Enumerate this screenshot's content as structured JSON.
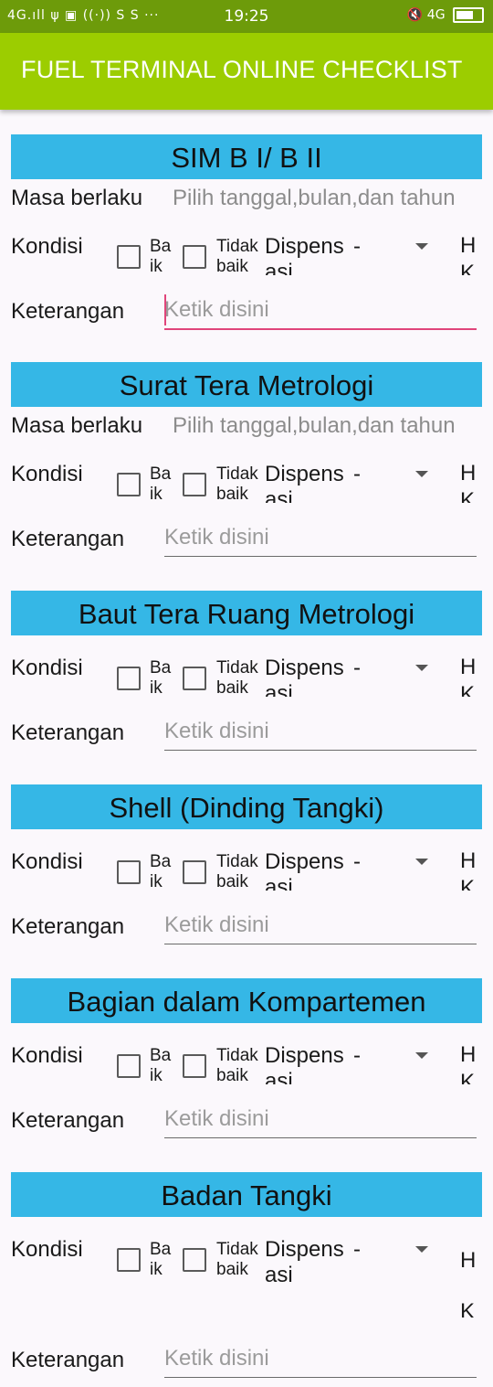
{
  "status_bar": {
    "left": "4G.ıll  ψ  ▣  ((·))  S  S  ···",
    "time": "19:25",
    "right": "🔇 4G"
  },
  "app_bar": {
    "title": "FUEL TERMINAL ONLINE CHECKLIST",
    "color": "#9ccd00"
  },
  "common": {
    "masa_label": "Masa berlaku",
    "date_placeholder": "Pilih tanggal,bulan,dan tahun",
    "kondisi_label": "Kondisi",
    "baik_label": "Ba ik",
    "tidak_baik_label": "Tidak baik",
    "dispensasi_label": "Dispens asi",
    "dispensasi_value": "-",
    "hk_label": "H K",
    "keterangan_label": "Keterangan",
    "keterangan_placeholder": "Ketik disini"
  },
  "sections": [
    {
      "title": "SIM B I/ B II",
      "has_masa": true
    },
    {
      "title": "Surat Tera Metrologi",
      "has_masa": true
    },
    {
      "title": "Baut Tera Ruang Metrologi",
      "has_masa": false
    },
    {
      "title": "Shell (Dinding Tangki)",
      "has_masa": false
    },
    {
      "title": "Bagian dalam Kompartemen",
      "has_masa": false
    },
    {
      "title": "Badan Tangki",
      "has_masa": false
    }
  ],
  "colors": {
    "header_bg": "#35b7e6",
    "focus_accent": "#e0457b"
  }
}
